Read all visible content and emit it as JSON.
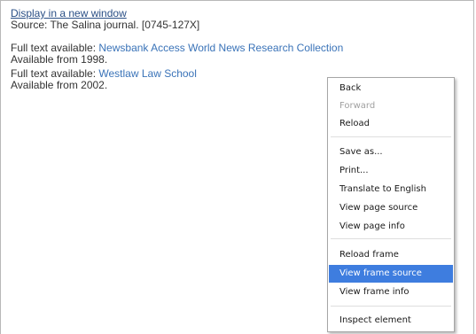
{
  "page": {
    "display_link": "Display in a new window",
    "source_text": "Source: The Salina journal. [0745-127X]",
    "holdings": [
      {
        "prefix": "Full text available: ",
        "link": "Newsbank Access World News Research Collection",
        "availability": "Available from 1998."
      },
      {
        "prefix": "Full text available: ",
        "link": "Westlaw Law School",
        "availability": "Available from 2002."
      }
    ]
  },
  "context_menu": {
    "items": [
      {
        "label": "Back",
        "enabled": true
      },
      {
        "label": "Forward",
        "enabled": false
      },
      {
        "label": "Reload",
        "enabled": true
      },
      {
        "label": "Save as...",
        "enabled": true
      },
      {
        "label": "Print...",
        "enabled": true
      },
      {
        "label": "Translate to English",
        "enabled": true
      },
      {
        "label": "View page source",
        "enabled": true
      },
      {
        "label": "View page info",
        "enabled": true
      },
      {
        "label": "Reload frame",
        "enabled": true
      },
      {
        "label": "View frame source",
        "enabled": true,
        "highlighted": true
      },
      {
        "label": "View frame info",
        "enabled": true
      },
      {
        "label": "Inspect element",
        "enabled": true
      }
    ],
    "colors": {
      "highlight": "#3e7ddf",
      "disabled_text": "#a0a0a0"
    }
  }
}
